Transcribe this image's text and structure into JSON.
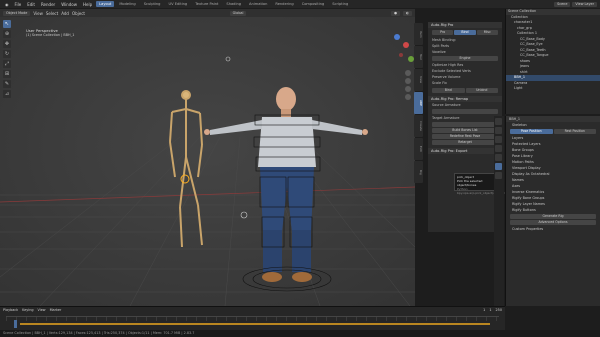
{
  "menu": [
    "File",
    "Edit",
    "Render",
    "Window",
    "Help"
  ],
  "workspaces": [
    "Layout",
    "Modeling",
    "Sculpting",
    "UV Editing",
    "Texture Paint",
    "Shading",
    "Animation",
    "Rendering",
    "Compositing",
    "Scripting"
  ],
  "scene": "Scene",
  "view_layer": "View Layer",
  "viewport": {
    "mode": "Object Mode",
    "menus": [
      "View",
      "Select",
      "Add",
      "Object"
    ],
    "orientation": "Global",
    "persp_line1": "User Perspective",
    "persp_line2": "(1) Scene Collection | BBH_1"
  },
  "tools": [
    "cursor",
    "move",
    "rotate",
    "scale",
    "transform",
    "annotate",
    "measure"
  ],
  "autorig": {
    "title": "Auto-Rig Pro",
    "tabs": [
      "Pro",
      "Bind",
      "Misc"
    ],
    "rows": [
      "Mesh Binding:",
      "Split Parts",
      "Voxelize",
      "Engine",
      "Optimize High Res",
      "Exclude Selected Verts",
      "Preserve Volume",
      "Scale Fix"
    ],
    "buttons": [
      "Bind",
      "Unbind"
    ],
    "remap_title": "Auto-Rig Pro: Remap",
    "source": "Source Armature",
    "target": "Target Armature",
    "actions": [
      "Build Bones List",
      "Redefine Rest Pose",
      "Retarget"
    ],
    "export_title": "Auto-Rig Pro: Export"
  },
  "side_tabs": [
    "Item",
    "Tool",
    "View",
    "ARP",
    "Create",
    "Edit",
    "Rig"
  ],
  "tooltip": {
    "line1": "pick_object",
    "line2": "Pick the selected object/bones",
    "line3": "Python: bpy.ops.arp.pick_object(action='pick_source')"
  },
  "outliner": {
    "title": "Scene Collection",
    "rows": [
      "Collection",
      "character1",
      "char_grp",
      "Collection 1",
      "CC_Base_Body",
      "CC_Base_Eye",
      "CC_Base_Teeth",
      "CC_Base_Tongue",
      "shoes",
      "jeans",
      "shirt",
      "BBH_1",
      "Camera",
      "Light"
    ]
  },
  "properties": {
    "object": "BBH_1",
    "rows": [
      "Skeleton",
      "Pose Position",
      "Rest Position",
      "Layers",
      "Protected Layers",
      "Bone Groups",
      "Pose Library",
      "Motion Paths",
      "Viewport Display",
      "Display As  Octahedral",
      "Names",
      "Axes",
      "Inverse Kinematics",
      "Rigify Bone Groups",
      "Rigify Layer Names",
      "Rigify Buttons",
      "Generate Rig",
      "Advanced Options",
      "Custom Properties"
    ]
  },
  "timeline": {
    "menus": [
      "Playback",
      "Keying",
      "View",
      "Marker"
    ],
    "start": "1",
    "end": "250",
    "current": "1"
  },
  "status_text": "Scene Collection | BBH_1 | Verts:129,134 | Faces:125,413 | Tris:250,374 | Objects:1/11 | Mem: 701.7 MiB | 2.83.7"
}
